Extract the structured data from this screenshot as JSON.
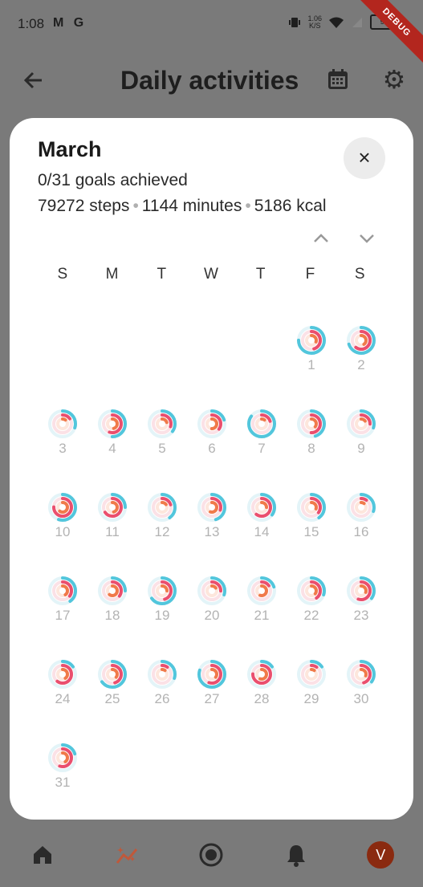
{
  "status_bar": {
    "time": "1:08",
    "left_icons": "M G",
    "rate_top": "1.06",
    "rate_bottom": "K/S",
    "battery": "99",
    "debug_label": "DEBUG"
  },
  "app_bar": {
    "title": "Daily activities"
  },
  "modal": {
    "month": "March",
    "goals": "0/31 goals achieved",
    "steps": "79272 steps",
    "minutes": "1144 minutes",
    "kcal": "5186 kcal",
    "close_label": "×",
    "weekdays": [
      "S",
      "M",
      "T",
      "W",
      "T",
      "F",
      "S"
    ],
    "days": [
      {
        "day": "1",
        "outer": 0.75,
        "mid": 0.45,
        "inner": 0.3
      },
      {
        "day": "2",
        "outer": 0.7,
        "mid": 0.6,
        "inner": 0.4
      },
      {
        "day": "3",
        "outer": 0.3,
        "mid": 0.15,
        "inner": 0.1
      },
      {
        "day": "4",
        "outer": 0.5,
        "mid": 0.55,
        "inner": 0.45
      },
      {
        "day": "5",
        "outer": 0.35,
        "mid": 0.3,
        "inner": 0.2
      },
      {
        "day": "6",
        "outer": 0.2,
        "mid": 0.35,
        "inner": 0.5
      },
      {
        "day": "7",
        "outer": 0.85,
        "mid": 0.2,
        "inner": 0.1
      },
      {
        "day": "8",
        "outer": 0.45,
        "mid": 0.5,
        "inner": 0.35
      },
      {
        "day": "9",
        "outer": 0.3,
        "mid": 0.25,
        "inner": 0.15
      },
      {
        "day": "10",
        "outer": 0.55,
        "mid": 0.75,
        "inner": 0.6
      },
      {
        "day": "11",
        "outer": 0.25,
        "mid": 0.65,
        "inner": 0.45
      },
      {
        "day": "12",
        "outer": 0.4,
        "mid": 0.2,
        "inner": 0.15
      },
      {
        "day": "13",
        "outer": 0.45,
        "mid": 0.3,
        "inner": 0.55
      },
      {
        "day": "14",
        "outer": 0.35,
        "mid": 0.6,
        "inner": 0.25
      },
      {
        "day": "15",
        "outer": 0.4,
        "mid": 0.35,
        "inner": 0.3
      },
      {
        "day": "16",
        "outer": 0.3,
        "mid": 0.1,
        "inner": 0.1
      },
      {
        "day": "17",
        "outer": 0.4,
        "mid": 0.35,
        "inner": 0.4
      },
      {
        "day": "18",
        "outer": 0.25,
        "mid": 0.35,
        "inner": 0.6
      },
      {
        "day": "19",
        "outer": 0.65,
        "mid": 0.45,
        "inner": 0.25
      },
      {
        "day": "20",
        "outer": 0.3,
        "mid": 0.25,
        "inner": 0.15
      },
      {
        "day": "21",
        "outer": 0.2,
        "mid": 0.15,
        "inner": 0.55
      },
      {
        "day": "22",
        "outer": 0.3,
        "mid": 0.4,
        "inner": 0.35
      },
      {
        "day": "23",
        "outer": 0.35,
        "mid": 0.55,
        "inner": 0.3
      },
      {
        "day": "24",
        "outer": 0.15,
        "mid": 0.6,
        "inner": 0.4
      },
      {
        "day": "25",
        "outer": 0.65,
        "mid": 0.45,
        "inner": 0.35
      },
      {
        "day": "26",
        "outer": 0.3,
        "mid": 0.1,
        "inner": 0.1
      },
      {
        "day": "27",
        "outer": 0.8,
        "mid": 0.55,
        "inner": 0.35
      },
      {
        "day": "28",
        "outer": 0.15,
        "mid": 0.75,
        "inner": 0.55
      },
      {
        "day": "29",
        "outer": 0.15,
        "mid": 0.1,
        "inner": 0.1
      },
      {
        "day": "30",
        "outer": 0.35,
        "mid": 0.45,
        "inner": 0.3
      },
      {
        "day": "31",
        "outer": 0.2,
        "mid": 0.55,
        "inner": 0.4
      }
    ],
    "first_weekday_index": 5
  },
  "bottom_nav": {
    "avatar_letter": "V"
  },
  "colors": {
    "outer_ring": "#52c6dc",
    "mid_ring": "#ea4f6e",
    "inner_ring": "#f07a4a",
    "track_outer": "#e3f4f8",
    "track_mid": "#fbe1e6",
    "track_inner": "#fde6dc",
    "active_nav": "#c0583a"
  }
}
